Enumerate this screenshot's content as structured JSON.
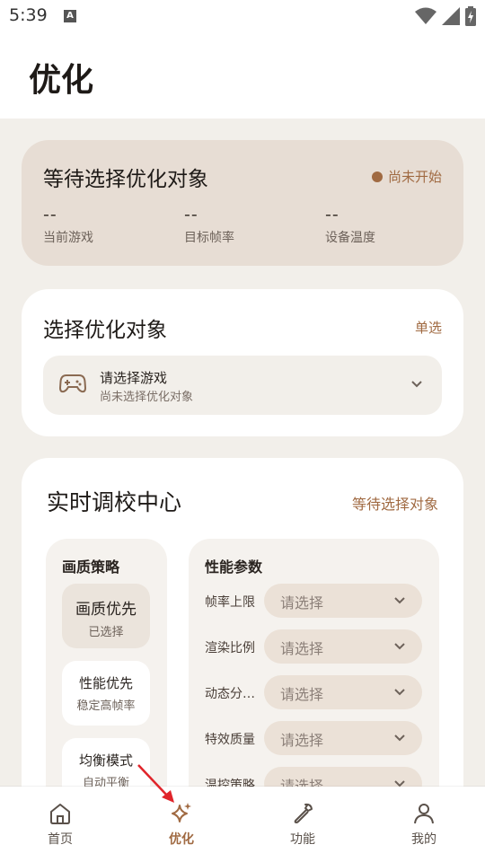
{
  "status_bar": {
    "time": "5:39",
    "notification_letter": "A"
  },
  "page": {
    "title": "优化"
  },
  "status_card": {
    "title": "等待选择优化对象",
    "badge": "尚未开始",
    "stats": [
      {
        "value": "--",
        "label": "当前游戏"
      },
      {
        "value": "--",
        "label": "目标帧率"
      },
      {
        "value": "--",
        "label": "设备温度"
      }
    ]
  },
  "select_card": {
    "title": "选择优化对象",
    "mode": "单选",
    "picker": {
      "main": "请选择游戏",
      "sub": "尚未选择优化对象"
    }
  },
  "tuning_card": {
    "title": "实时调校中心",
    "status": "等待选择对象",
    "strategy": {
      "header": "画质策略",
      "options": [
        {
          "name": "画质优先",
          "desc": "已选择"
        },
        {
          "name": "性能优先",
          "desc": "稳定高帧率"
        },
        {
          "name": "均衡模式",
          "desc": "自动平衡"
        }
      ]
    },
    "params": {
      "header": "性能参数",
      "rows": [
        {
          "label": "帧率上限",
          "value": "请选择"
        },
        {
          "label": "渲染比例",
          "value": "请选择"
        },
        {
          "label": "动态分辨…",
          "value": "请选择"
        },
        {
          "label": "特效质量",
          "value": "请选择"
        },
        {
          "label": "温控策略",
          "value": "请选择"
        }
      ]
    }
  },
  "bottom_nav": [
    {
      "label": "首页",
      "icon": "home-icon"
    },
    {
      "label": "优化",
      "icon": "sparkle-icon",
      "active": true
    },
    {
      "label": "功能",
      "icon": "wrench-icon"
    },
    {
      "label": "我的",
      "icon": "person-icon"
    }
  ],
  "colors": {
    "accent": "#a06a42",
    "status_card_bg": "#e7ddd4",
    "page_bg": "#f2efea",
    "arrow": "#e0242a"
  }
}
